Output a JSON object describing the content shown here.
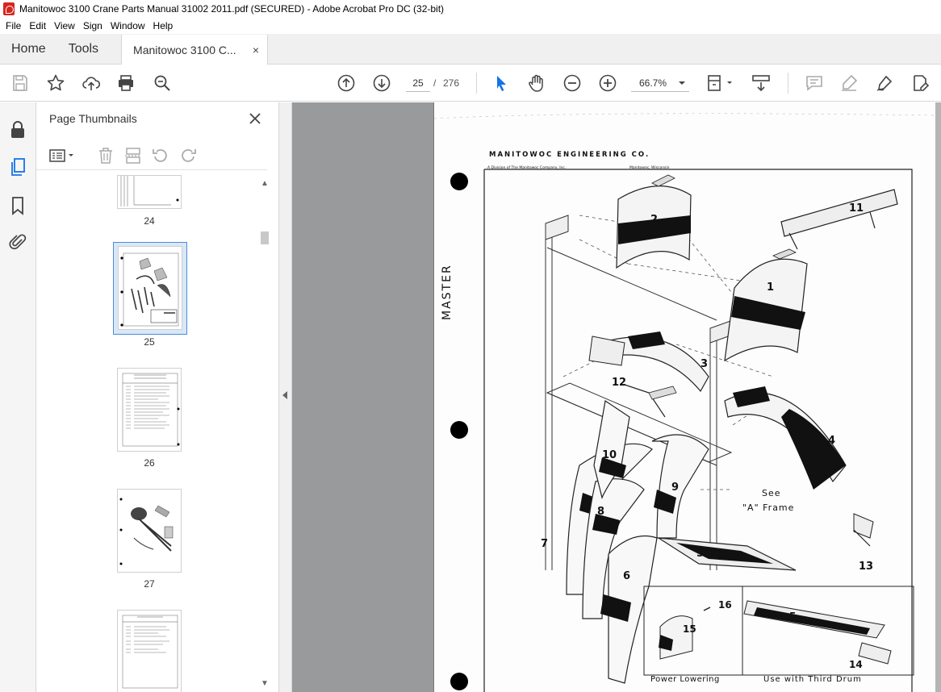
{
  "window": {
    "title": "Manitowoc 3100 Crane Parts Manual 31002 2011.pdf (SECURED) - Adobe Acrobat Pro DC (32-bit)"
  },
  "menu": [
    "File",
    "Edit",
    "View",
    "Sign",
    "Window",
    "Help"
  ],
  "tabs": {
    "home": "Home",
    "tools": "Tools",
    "document": "Manitowoc 3100 C...",
    "close_glyph": "×"
  },
  "toolbar": {
    "current_page": "25",
    "page_separator": "/",
    "total_pages": "276",
    "zoom": "66.7%"
  },
  "panel": {
    "title": "Page Thumbnails",
    "thumbnails": [
      {
        "label": "24"
      },
      {
        "label": "25",
        "selected": true
      },
      {
        "label": "26"
      },
      {
        "label": "27"
      },
      {
        "label": ""
      }
    ]
  },
  "document": {
    "company": "MANITOWOC ENGINEERING CO.",
    "division": "A Division of The Manitowoc Company, Inc.",
    "location": "Manitowoc, Wisconsin",
    "stamp": "MASTER",
    "part_numbers": [
      "1",
      "2",
      "3",
      "4",
      "5",
      "6",
      "7",
      "8",
      "9",
      "10",
      "11",
      "12",
      "13"
    ],
    "callout_see": "See",
    "callout_frame": "\"A\" Frame",
    "inset_left_numbers": [
      "15",
      "16"
    ],
    "inset_right_numbers": [
      "5",
      "14"
    ],
    "caption_left": "Power Lowering",
    "caption_right": "Use with Third Drum"
  }
}
